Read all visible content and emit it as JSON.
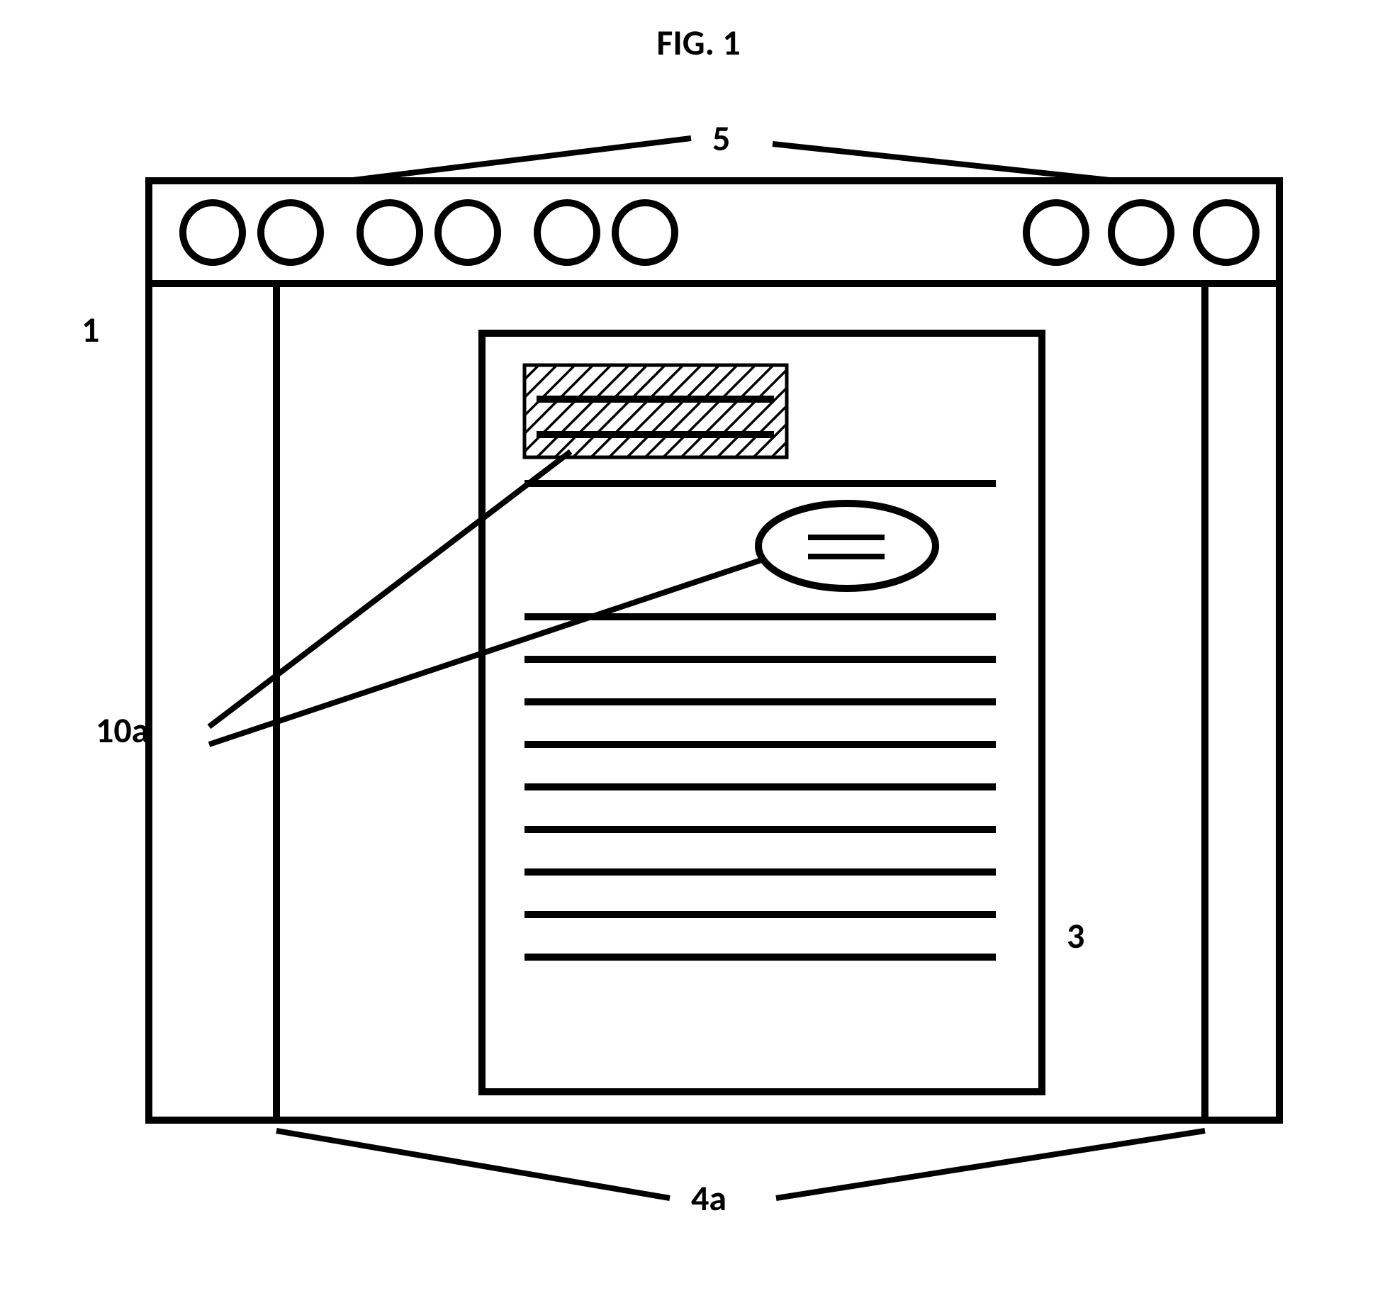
{
  "figure": {
    "title": "FIG. 1"
  },
  "labels": {
    "top": "5",
    "left": "1",
    "docLabel": "3",
    "bottom": "4a",
    "overlay": "10a"
  }
}
